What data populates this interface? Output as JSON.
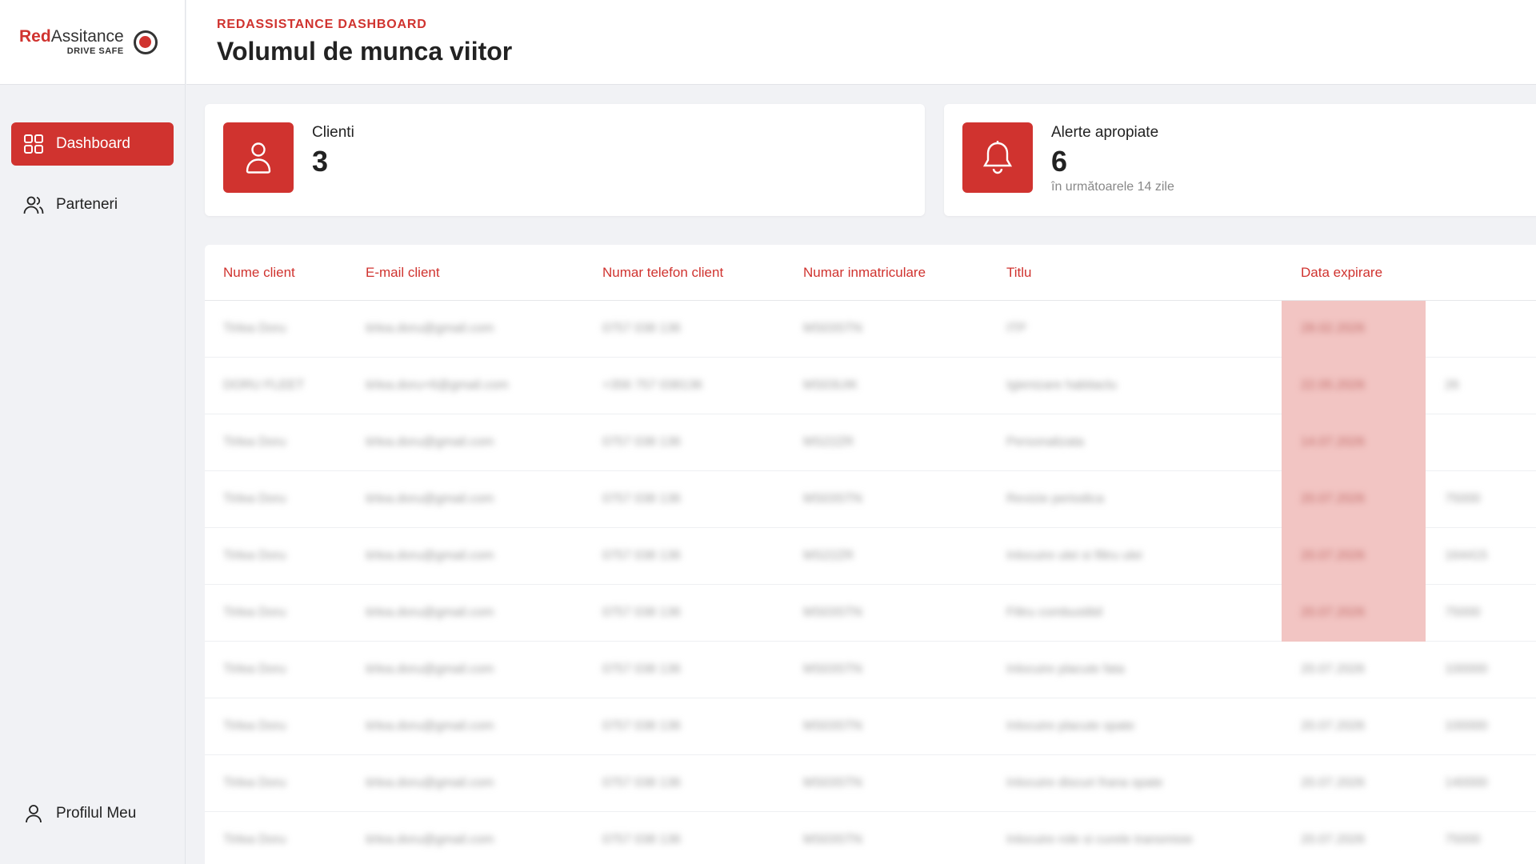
{
  "brand": {
    "name_red": "Red",
    "name_grey": "Assitance",
    "tagline": "DRIVE SAFE",
    "accent": "#d0332f"
  },
  "sidebar": {
    "items": [
      {
        "label": "Dashboard",
        "icon": "grid-icon",
        "active": true
      },
      {
        "label": "Parteneri",
        "icon": "users-icon",
        "active": false
      }
    ],
    "profile": {
      "label": "Profilul Meu",
      "icon": "user-icon"
    }
  },
  "header": {
    "kicker": "REDASSISTANCE DASHBOARD",
    "title": "Volumul de munca viitor"
  },
  "stats": {
    "clients": {
      "label": "Clienti",
      "value": "3",
      "icon": "user-icon"
    },
    "alerts": {
      "label": "Alerte apropiate",
      "value": "6",
      "sub": "în următoarele 14 zile",
      "icon": "bell-icon"
    }
  },
  "table": {
    "columns": [
      "Nume client",
      "E-mail client",
      "Numar telefon client",
      "Numar inmatriculare",
      "Titlu",
      "Data expirare"
    ],
    "rows": [
      {
        "name": "Tirlea Doru",
        "email": "tirlea.doru@gmail.com",
        "phone": "0757 038 136",
        "plate": "MS03STN",
        "title": "ITP",
        "date": "28.02.2026",
        "extra": "",
        "highlight": true
      },
      {
        "name": "DORU FLEET",
        "email": "tirlea.doru+6@gmail.com",
        "phone": "+356 757 038136",
        "plate": "MS03UIK",
        "title": "Igienizare habitaclu",
        "date": "22.05.2026",
        "extra": "26",
        "highlight": true
      },
      {
        "name": "Tirlea Doru",
        "email": "tirlea.doru@gmail.com",
        "phone": "0757 038 136",
        "plate": "MS22ZR",
        "title": "Personalizata",
        "date": "14.07.2026",
        "extra": "",
        "highlight": true
      },
      {
        "name": "Tirlea Doru",
        "email": "tirlea.doru@gmail.com",
        "phone": "0757 038 136",
        "plate": "MS03STN",
        "title": "Revizie periodica",
        "date": "20.07.2026",
        "extra": "75000",
        "highlight": true
      },
      {
        "name": "Tirlea Doru",
        "email": "tirlea.doru@gmail.com",
        "phone": "0757 038 136",
        "plate": "MS22ZR",
        "title": "Inlocuire ulei si filtru ulei",
        "date": "20.07.2026",
        "extra": "164415",
        "highlight": true
      },
      {
        "name": "Tirlea Doru",
        "email": "tirlea.doru@gmail.com",
        "phone": "0757 038 136",
        "plate": "MS03STN",
        "title": "Filtru combustibil",
        "date": "20.07.2026",
        "extra": "75000",
        "highlight": true
      },
      {
        "name": "Tirlea Doru",
        "email": "tirlea.doru@gmail.com",
        "phone": "0757 038 136",
        "plate": "MS03STN",
        "title": "Inlocuire placute fata",
        "date": "20.07.2026",
        "extra": "100000",
        "highlight": false
      },
      {
        "name": "Tirlea Doru",
        "email": "tirlea.doru@gmail.com",
        "phone": "0757 038 136",
        "plate": "MS03STN",
        "title": "Inlocuire placute spate",
        "date": "20.07.2026",
        "extra": "100000",
        "highlight": false
      },
      {
        "name": "Tirlea Doru",
        "email": "tirlea.doru@gmail.com",
        "phone": "0757 038 136",
        "plate": "MS03STN",
        "title": "Inlocuire discuri frana spate",
        "date": "20.07.2026",
        "extra": "140000",
        "highlight": false
      },
      {
        "name": "Tirlea Doru",
        "email": "tirlea.doru@gmail.com",
        "phone": "0757 038 136",
        "plate": "MS03STN",
        "title": "Inlocuire role si curele transmisie",
        "date": "20.07.2026",
        "extra": "75000",
        "highlight": false
      }
    ]
  }
}
